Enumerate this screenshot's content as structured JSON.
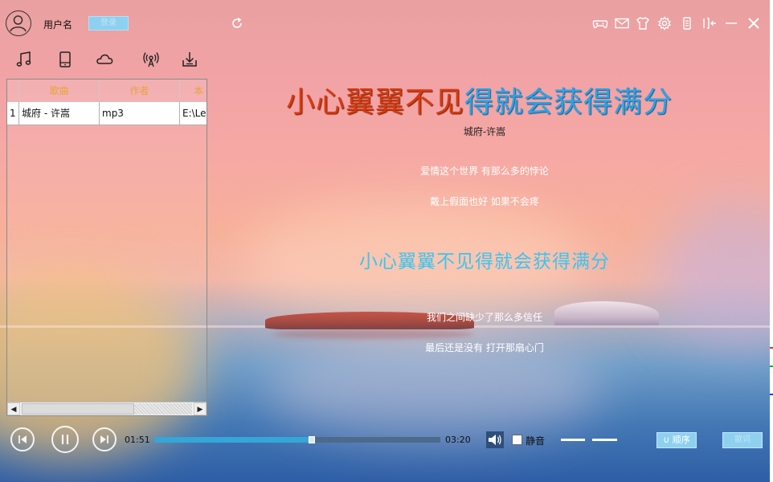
{
  "user": {
    "name": "用户名",
    "login_label": "登录"
  },
  "playlist": {
    "headers": [
      "",
      "歌曲",
      "作者",
      "本"
    ],
    "rows": [
      {
        "index": "1",
        "song": "城府 - 许嵩",
        "author": "mp3",
        "path": "E:\\Lea"
      }
    ]
  },
  "lyrics": {
    "title_part1": "小心翼翼不见",
    "title_part2": "得就会获得满分",
    "artist_line": "城府-许嵩",
    "line1": "爱情这个世界 有那么多的悖论",
    "line2": "戴上假面也好 如果不会疼",
    "current": "小心翼翼不见得就会获得满分",
    "line3": "我们之间缺少了那么多信任",
    "line4": "最后还是没有 打开那扇心门"
  },
  "player": {
    "elapsed": "01:51",
    "total": "03:20",
    "progress": 0.55,
    "mute_label": "静音",
    "order_label": "顺序",
    "lyric_label": "歌词"
  },
  "colors": {
    "title_red": "#d73a12",
    "title_blue": "#2aa4e6",
    "current_lyric": "#3cc4f0",
    "header_text": "#e8a23c",
    "button_bg": "#8ed0ef"
  }
}
